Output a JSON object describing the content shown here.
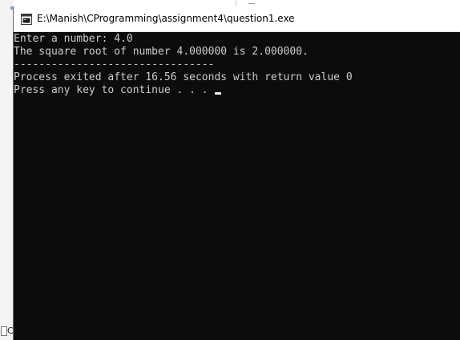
{
  "window": {
    "title": "E:\\Manish\\CProgramming\\assignment4\\question1.exe",
    "icon": "console-app-icon"
  },
  "console": {
    "lines": [
      "Enter a number: 4.0",
      "The square root of number 4.000000 is 2.000000.",
      "--------------------------------",
      "Process exited after 16.56 seconds with return value 0",
      "Press any key to continue . . . "
    ]
  },
  "background": {
    "left_letter": "C"
  },
  "colors": {
    "console_background": "#0c0c0c",
    "console_text": "#cccccc",
    "title_bar": "#ffffff",
    "cursor": "#f2f2f2"
  }
}
